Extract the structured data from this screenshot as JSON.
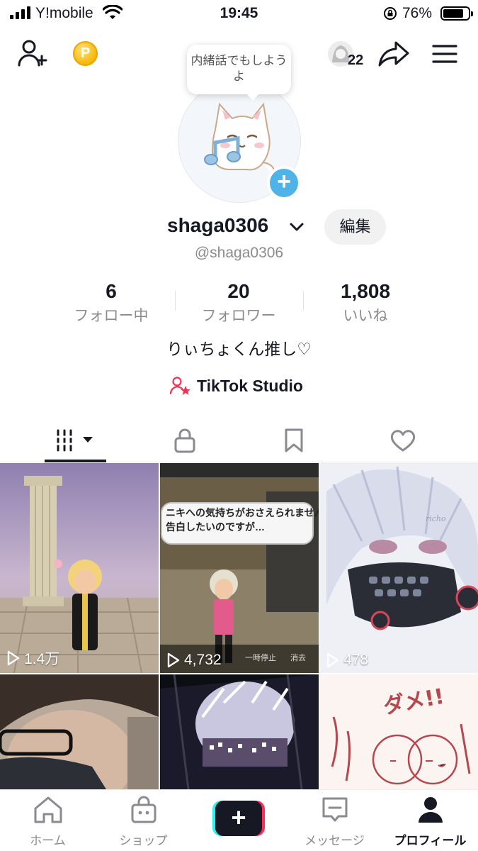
{
  "status_bar": {
    "carrier": "Y!mobile",
    "time": "19:45",
    "battery_percent": "76%",
    "battery_level": 0.76
  },
  "top_bar": {
    "coin_letter": "P",
    "notification_count": "22",
    "icons": [
      "add-user-icon",
      "coin-icon",
      "share-icon",
      "menu-icon"
    ]
  },
  "profile": {
    "bubble_text": "内緒話でもしようよ",
    "username": "shaga0306",
    "handle": "@shaga0306",
    "edit_label": "編集",
    "bio": "りぃちょくん推し♡",
    "studio_label": "TikTok Studio"
  },
  "stats": [
    {
      "value": "6",
      "label": "フォロー中"
    },
    {
      "value": "20",
      "label": "フォロワー"
    },
    {
      "value": "1,808",
      "label": "いいね"
    }
  ],
  "tabs": [
    "videos-grid-icon",
    "lock-icon",
    "bookmark-icon",
    "heart-icon"
  ],
  "videos": [
    {
      "views": "1.4万"
    },
    {
      "views": "4,732",
      "overlay_line1": "ニキへの気持ちがおさえられません",
      "overlay_line2": "告白したいのですが…",
      "pause_label": "一時停止",
      "delete_label": "消去"
    },
    {
      "views": "478",
      "signature": "richo"
    },
    {
      "views": ""
    },
    {
      "views": ""
    },
    {
      "views": "",
      "doodle_text": "ダメ!!"
    }
  ],
  "bottom_nav": [
    {
      "label": "ホーム",
      "icon": "home-icon"
    },
    {
      "label": "ショップ",
      "icon": "shop-icon"
    },
    {
      "label": "",
      "icon": "create-icon"
    },
    {
      "label": "メッセージ",
      "icon": "inbox-icon"
    },
    {
      "label": "プロフィール",
      "icon": "profile-icon",
      "active": true
    }
  ],
  "colors": {
    "accent_blue": "#4fb3e8",
    "tiktok_red": "#fe2c55",
    "tiktok_cyan": "#25f4ee",
    "text_secondary": "#8a8b91"
  }
}
